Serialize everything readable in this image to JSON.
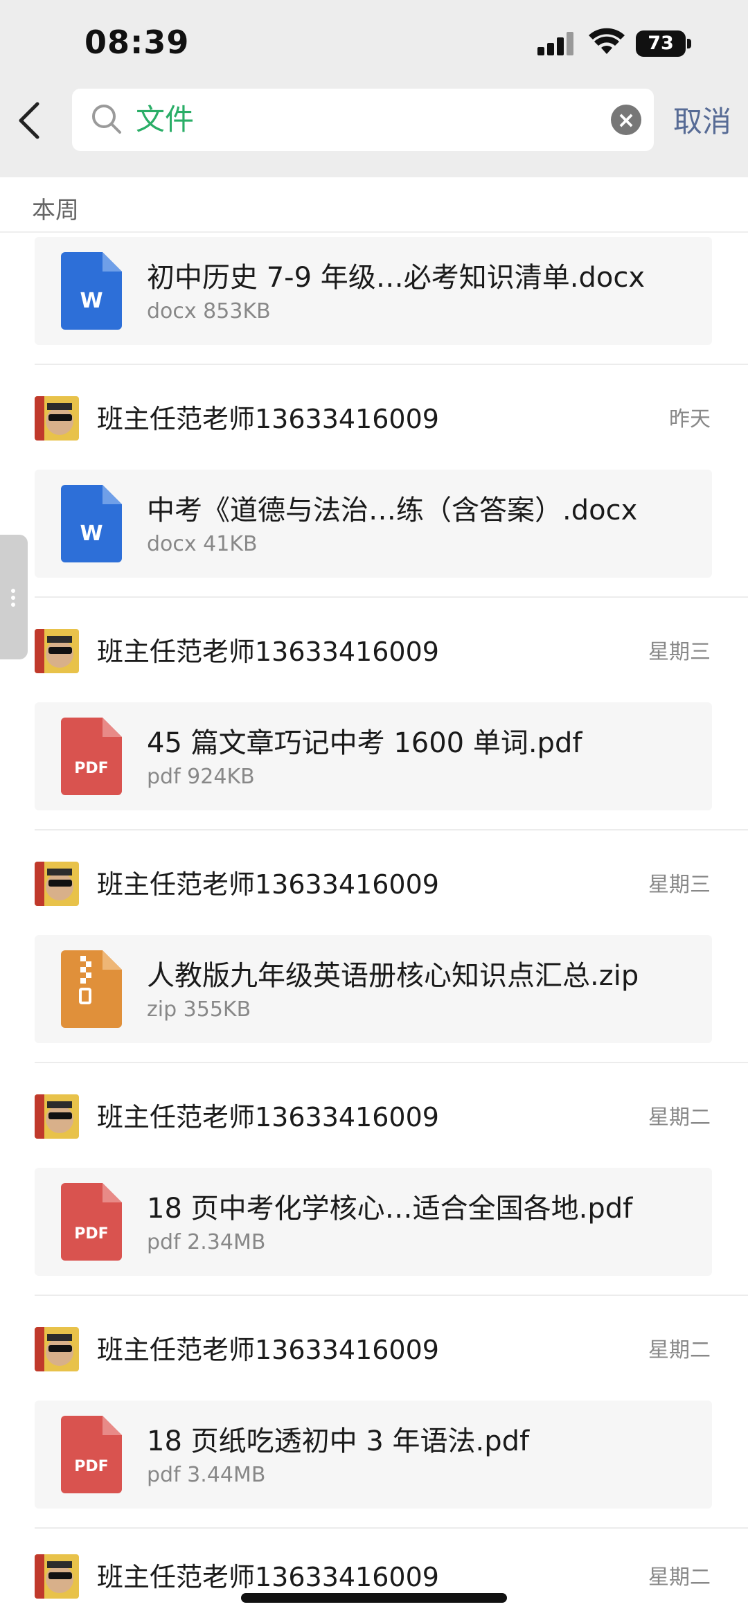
{
  "status_bar": {
    "time": "08:39",
    "battery": "73"
  },
  "search": {
    "query": "文件",
    "cancel_label": "取消"
  },
  "section": {
    "label": "本周"
  },
  "colors": {
    "accent_green": "#2aae67",
    "link_blue": "#576b95",
    "word_blue": "#2d6fd8",
    "pdf_red": "#d9534f",
    "zip_orange": "#e0903a"
  },
  "first_file": {
    "name": "初中历史 7-9 年级…必考知识清单.docx",
    "meta": "docx 853KB",
    "type": "word"
  },
  "groups": [
    {
      "sender": "班主任范老师13633416009",
      "date": "昨天",
      "file": {
        "name": "中考《道德与法治…练（含答案）.docx",
        "meta": "docx 41KB",
        "type": "word"
      }
    },
    {
      "sender": "班主任范老师13633416009",
      "date": "星期三",
      "file": {
        "name": "45 篇文章巧记中考 1600 单词.pdf",
        "meta": "pdf 924KB",
        "type": "pdf"
      }
    },
    {
      "sender": "班主任范老师13633416009",
      "date": "星期三",
      "file": {
        "name": "人教版九年级英语册核心知识点汇总.zip",
        "meta": "zip 355KB",
        "type": "zip"
      }
    },
    {
      "sender": "班主任范老师13633416009",
      "date": "星期二",
      "file": {
        "name": "18 页中考化学核心…适合全国各地.pdf",
        "meta": "pdf 2.34MB",
        "type": "pdf"
      }
    },
    {
      "sender": "班主任范老师13633416009",
      "date": "星期二",
      "file": {
        "name": "18 页纸吃透初中 3 年语法.pdf",
        "meta": "pdf 3.44MB",
        "type": "pdf"
      }
    }
  ],
  "last_sender": {
    "sender": "班主任范老师13633416009",
    "date": "星期二"
  },
  "icons": {
    "back": "chevron-left-icon",
    "search": "search-icon",
    "clear": "clear-icon"
  }
}
